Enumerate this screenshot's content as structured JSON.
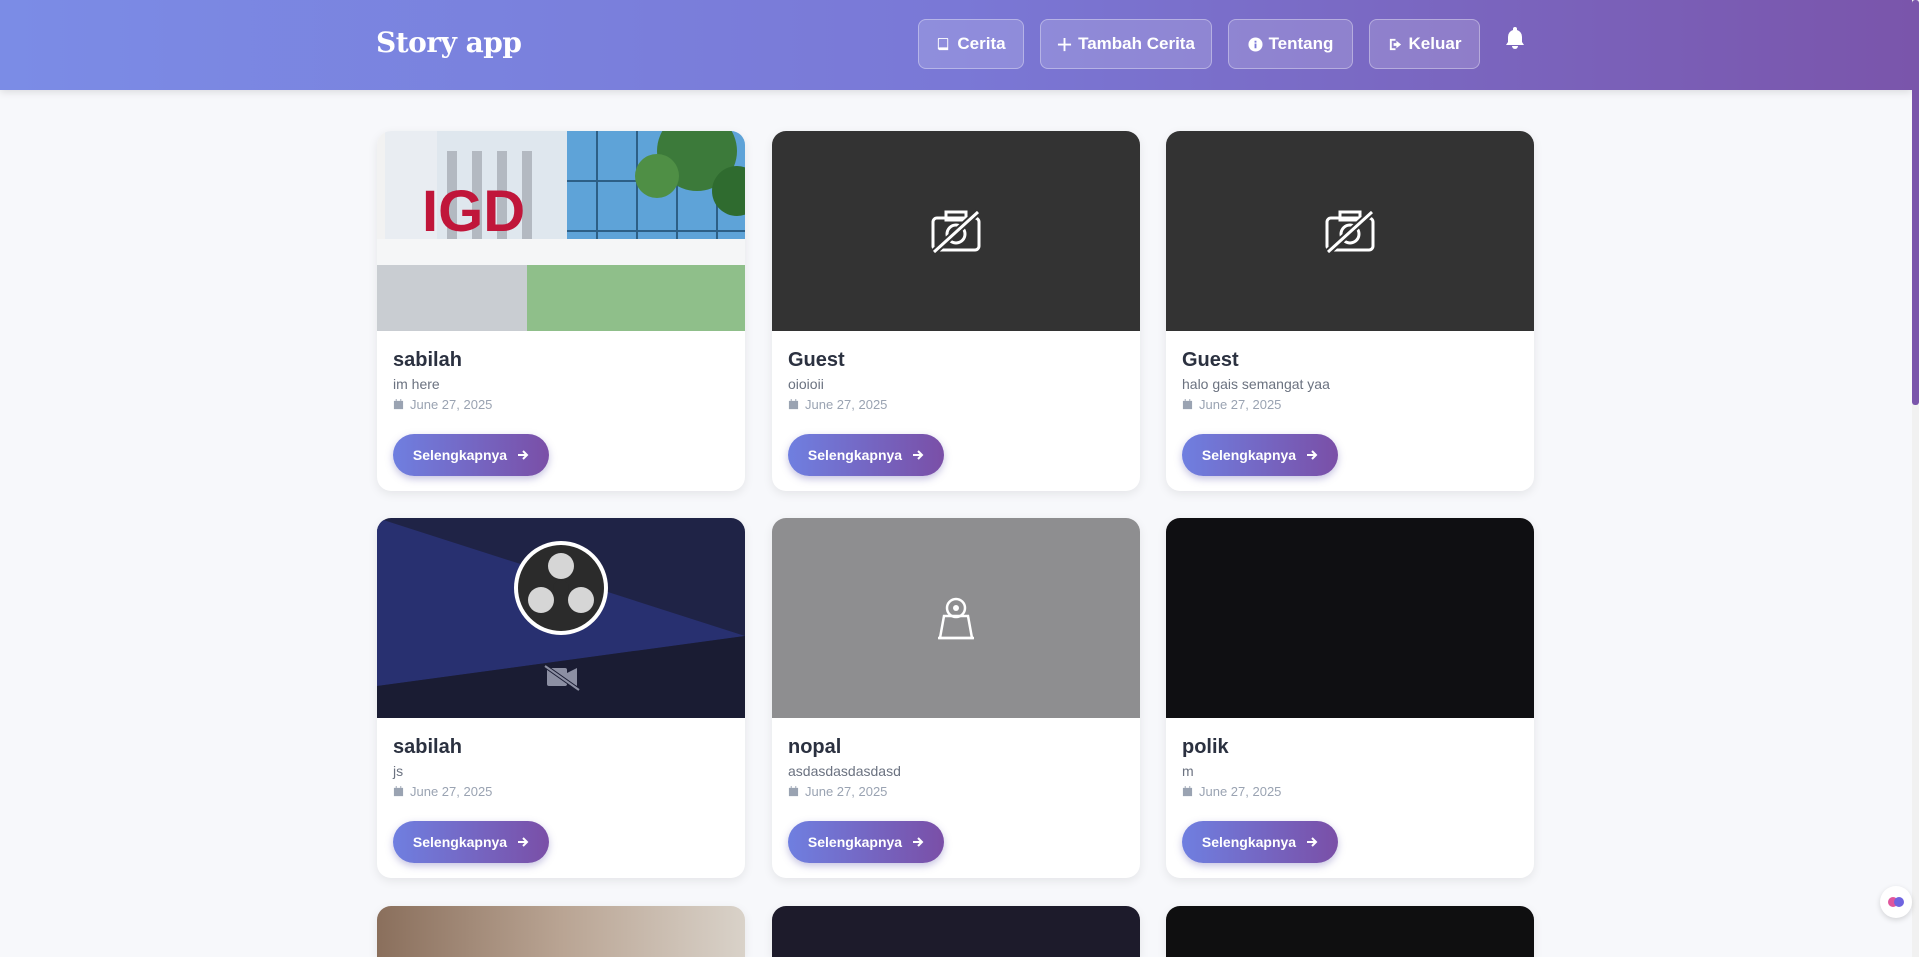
{
  "header": {
    "brand": "Story app",
    "nav": [
      {
        "label": "Cerita",
        "icon": "book-icon"
      },
      {
        "label": "Tambah Cerita",
        "icon": "plus-icon"
      },
      {
        "label": "Tentang",
        "icon": "info-icon"
      },
      {
        "label": "Keluar",
        "icon": "logout-icon"
      }
    ],
    "notification_icon": "bell-icon"
  },
  "colors": {
    "header_gradient": [
      "#7b8ce6",
      "#7a55ab"
    ],
    "button_gradient": [
      "#6f7fe0",
      "#7a4fa7"
    ],
    "title": "#2b3140"
  },
  "stories": [
    {
      "name": "sabilah",
      "description": "im here",
      "date": "June 27, 2025",
      "image": "photo-igd-building",
      "button": "Selengkapnya"
    },
    {
      "name": "Guest",
      "description": "oioioii",
      "date": "June 27, 2025",
      "image": "no-image-camera-off-icon",
      "button": "Selengkapnya"
    },
    {
      "name": "Guest",
      "description": "halo gais semangat yaa",
      "date": "June 27, 2025",
      "image": "no-image-camera-off-icon",
      "button": "Selengkapnya"
    },
    {
      "name": "sabilah",
      "description": "js",
      "date": "June 27, 2025",
      "image": "obs-logo-screenshot",
      "button": "Selengkapnya"
    },
    {
      "name": "nopal",
      "description": "asdasdasdasdasd",
      "date": "June 27, 2025",
      "image": "webcam-placeholder",
      "button": "Selengkapnya"
    },
    {
      "name": "polik",
      "description": "m",
      "date": "June 27, 2025",
      "image": "dark-photo",
      "button": "Selengkapnya"
    }
  ]
}
